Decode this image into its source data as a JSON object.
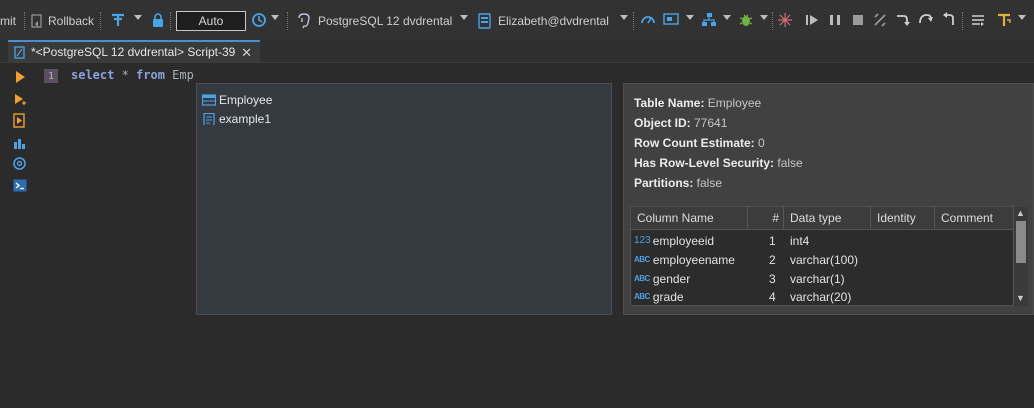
{
  "toolbar": {
    "commit_label": "mit",
    "rollback_label": "Rollback",
    "transaction_mode_value": "Auto",
    "datasource_label": "PostgreSQL 12 dvdrental",
    "schema_label": "Elizabeth@dvdrental"
  },
  "tab": {
    "title": "*<PostgreSQL 12 dvdrental> Script-39",
    "close_glyph": "✕"
  },
  "editor": {
    "line_number": "1",
    "code": {
      "kw1": "select",
      "star": " * ",
      "kw2": "from",
      "rest": " Emp"
    }
  },
  "autocomplete": {
    "items": [
      {
        "label": "Employee",
        "icon": "table-icon"
      },
      {
        "label": "example1",
        "icon": "script-icon"
      }
    ]
  },
  "info": {
    "table_name_label": "Table Name:",
    "table_name_value": " Employee",
    "object_id_label": "Object ID:",
    "object_id_value": " 77641",
    "row_count_label": "Row Count Estimate:",
    "row_count_value": " 0",
    "rls_label": "Has Row-Level Security:",
    "rls_value": " false",
    "partitions_label": "Partitions:",
    "partitions_value": " false",
    "columns_headers": [
      "Column Name",
      "#",
      "Data type",
      "Identity",
      "Comment"
    ],
    "columns": [
      {
        "tag": "123",
        "name": "employeeid",
        "num": "1",
        "type": "int4",
        "identity": "",
        "comment": ""
      },
      {
        "tag": "ABC",
        "name": "employeename",
        "num": "2",
        "type": "varchar(100)",
        "identity": "",
        "comment": ""
      },
      {
        "tag": "ABC",
        "name": "gender",
        "num": "3",
        "type": "varchar(1)",
        "identity": "",
        "comment": ""
      },
      {
        "tag": "ABC",
        "name": "grade",
        "num": "4",
        "type": "varchar(20)",
        "identity": "",
        "comment": ""
      }
    ]
  },
  "colors": {
    "accent": "#4a8fd0",
    "run_arrow": "#f0a030",
    "keyword": "#8aa3d8"
  }
}
